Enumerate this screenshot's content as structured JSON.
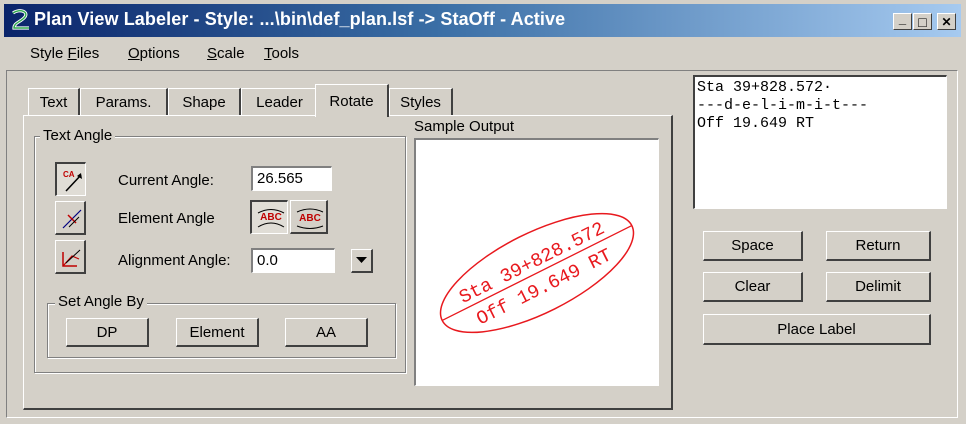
{
  "window": {
    "title": "Plan View Labeler - Style: ...\\bin\\def_plan.lsf -> StaOff - Active",
    "controls": {
      "minimize": "_",
      "maximize": "□",
      "close": "✕"
    }
  },
  "menu": [
    {
      "pre": "Style ",
      "u": "F",
      "post": "iles"
    },
    {
      "pre": "",
      "u": "O",
      "post": "ptions"
    },
    {
      "pre": "",
      "u": "S",
      "post": "cale"
    },
    {
      "pre": "",
      "u": "T",
      "post": "ools"
    }
  ],
  "tabs": [
    "Text",
    "Params.",
    "Shape",
    "Leader",
    "Rotate",
    "Styles"
  ],
  "active_tab": "Rotate",
  "rotate": {
    "text_angle_group": "Text Angle",
    "current_angle_label": "Current Angle:",
    "current_angle_value": "26.565",
    "element_angle_label": "Element Angle",
    "alignment_angle_label": "Alignment Angle:",
    "alignment_angle_value": "0.0",
    "set_angle_group": "Set Angle By",
    "buttons": {
      "dp": "DP",
      "element": "Element",
      "aa": "AA"
    },
    "icon_text": {
      "ca": "CA",
      "abc1": "ABC",
      "abc2": "ABC"
    }
  },
  "sample_output": {
    "label": "Sample Output",
    "line1": "Sta 39+828.572",
    "line2": "Off 19.649 RT",
    "color": "#e8191e"
  },
  "preview": {
    "lines": [
      "Sta 39+828.572·",
      "---d-e-l-i-m-i-t---",
      "Off 19.649 RT"
    ]
  },
  "actions": {
    "space": "Space",
    "return": "Return",
    "clear": "Clear",
    "delimit": "Delimit",
    "place_label": "Place Label"
  }
}
